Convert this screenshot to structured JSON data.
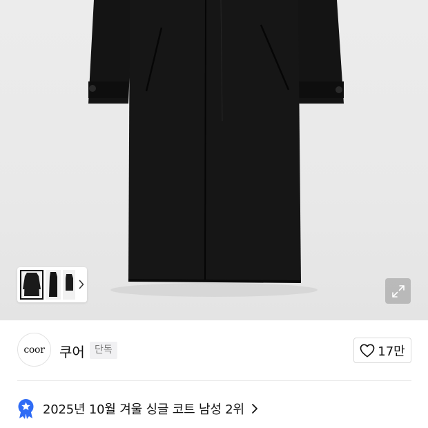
{
  "gallery": {
    "thumbnails": [
      {
        "name": "thumbnail-front",
        "selected": true
      },
      {
        "name": "thumbnail-side",
        "selected": false
      },
      {
        "name": "thumbnail-back",
        "selected": false
      }
    ],
    "next_icon": "chevron-right-icon",
    "expand_icon": "expand-arrows-icon"
  },
  "brand": {
    "logo_text": "coor",
    "name": "쿠어",
    "badge": "단독"
  },
  "like": {
    "icon": "heart-outline-icon",
    "count": "17만"
  },
  "ranking": {
    "icon": "star-ribbon-badge-icon",
    "text": "2025년 10월 겨울 싱글 코트 남성 2위",
    "chevron_icon": "chevron-right-icon"
  },
  "colors": {
    "hero_background": "#eaeaea",
    "coat": "#141414",
    "badge_blue": "#2f6cf5",
    "badge_background": "#f1f1f3",
    "divider": "#e8e8e8"
  }
}
